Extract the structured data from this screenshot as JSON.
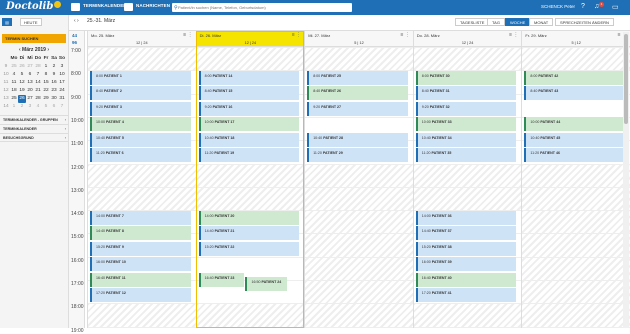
{
  "topbar": {
    "logo": "Doctolib",
    "logo_badge": "pro",
    "nav_calendar": "TERMINKALENDER",
    "nav_messages": "NACHRICHTEN",
    "search_placeholder": "Patient/in suchen (Name, Telefon, Geburtsdatum)",
    "user_name": "SCHENCK Peter",
    "notif_count": "1"
  },
  "sidebar": {
    "heute": "HEUTE",
    "termin_suchen": "TERMIN SUCHEN",
    "month": "März",
    "year": "2019",
    "weekday_headers": [
      "Mo",
      "Di",
      "Mi",
      "Do",
      "Fr",
      "Sa",
      "So"
    ],
    "weeks": [
      {
        "wk": "9",
        "days": [
          "25",
          "26",
          "27",
          "28",
          "1",
          "2",
          "3"
        ]
      },
      {
        "wk": "10",
        "days": [
          "4",
          "5",
          "6",
          "7",
          "8",
          "9",
          "10"
        ]
      },
      {
        "wk": "11",
        "days": [
          "11",
          "12",
          "13",
          "14",
          "15",
          "16",
          "17"
        ]
      },
      {
        "wk": "12",
        "days": [
          "18",
          "19",
          "20",
          "21",
          "22",
          "23",
          "24"
        ]
      },
      {
        "wk": "13",
        "days": [
          "25",
          "26",
          "27",
          "28",
          "29",
          "30",
          "31"
        ]
      },
      {
        "wk": "14",
        "days": [
          "1",
          "2",
          "3",
          "4",
          "5",
          "6",
          "7"
        ]
      }
    ],
    "sections": [
      "TERMINKALENDER - GRUPPEN",
      "TERMINKALENDER",
      "BESUCHSGRUND"
    ]
  },
  "toolbar": {
    "date_range": "25.-31. März",
    "views": [
      "TAGESLISTE",
      "TAG",
      "WOCHE",
      "MONAT",
      "SPRECHZEITEN ÄNDERN"
    ],
    "active_view": "WOCHE"
  },
  "zoom": {
    "a": "44",
    "b": "96"
  },
  "hours": [
    "7:00",
    "8:00",
    "9:00",
    "10:00",
    "11:00",
    "12:00",
    "13:00",
    "14:00",
    "15:00",
    "16:00",
    "17:00",
    "18:00",
    "19:00"
  ],
  "days": [
    {
      "title": "Mo. 25. März",
      "count": "12 | 24"
    },
    {
      "title": "Di. 26. März",
      "count": "12 | 24"
    },
    {
      "title": "Mi. 27. März",
      "count": "5 | 12"
    },
    {
      "title": "Do. 28. März",
      "count": "12 | 24"
    },
    {
      "title": "Fr. 29. März",
      "count": "5 | 12"
    }
  ],
  "appointments": [
    {
      "day": 0,
      "t": "8:00",
      "n": "PATIENT 1"
    },
    {
      "day": 0,
      "t": "8:40",
      "n": "PATIENT 2"
    },
    {
      "day": 0,
      "t": "9:20",
      "n": "PATIENT 3"
    },
    {
      "day": 0,
      "t": "10:00",
      "n": "PATIENT 4",
      "g": true
    },
    {
      "day": 0,
      "t": "10:40",
      "n": "PATIENT 5"
    },
    {
      "day": 0,
      "t": "11:20",
      "n": "PATIENT 6"
    },
    {
      "day": 0,
      "t": "14:00",
      "n": "PATIENT 7"
    },
    {
      "day": 0,
      "t": "14:40",
      "n": "PATIENT 8",
      "g": true
    },
    {
      "day": 0,
      "t": "15:20",
      "n": "PATIENT 9"
    },
    {
      "day": 0,
      "t": "16:00",
      "n": "PATIENT 10"
    },
    {
      "day": 0,
      "t": "16:40",
      "n": "PATIENT 11",
      "g": true
    },
    {
      "day": 0,
      "t": "17:20",
      "n": "PATIENT 12"
    },
    {
      "day": 1,
      "t": "8:00",
      "n": "PATIENT 14"
    },
    {
      "day": 1,
      "t": "8:40",
      "n": "PATIENT 15"
    },
    {
      "day": 1,
      "t": "9:20",
      "n": "PATIENT 16"
    },
    {
      "day": 1,
      "t": "10:00",
      "n": "PATIENT 17",
      "g": true
    },
    {
      "day": 1,
      "t": "10:40",
      "n": "PATIENT 18"
    },
    {
      "day": 1,
      "t": "11:20",
      "n": "PATIENT 19"
    },
    {
      "day": 1,
      "t": "14:00",
      "n": "PATIENT 20",
      "g": true
    },
    {
      "day": 1,
      "t": "14:40",
      "n": "PATIENT 21"
    },
    {
      "day": 1,
      "t": "15:20",
      "n": "PATIENT 22"
    },
    {
      "day": 1,
      "t": "16:40",
      "n": "PATIENT 23",
      "g": true
    },
    {
      "day": 1,
      "t": "16:50",
      "n": "PATIENT 24",
      "g": true
    },
    {
      "day": 2,
      "t": "8:00",
      "n": "PATIENT 25"
    },
    {
      "day": 2,
      "t": "8:40",
      "n": "PATIENT 26",
      "g": true
    },
    {
      "day": 2,
      "t": "9:20",
      "n": "PATIENT 27"
    },
    {
      "day": 2,
      "t": "10:40",
      "n": "PATIENT 28"
    },
    {
      "day": 2,
      "t": "11:20",
      "n": "PATIENT 29"
    },
    {
      "day": 3,
      "t": "8:00",
      "n": "PATIENT 30",
      "g": true
    },
    {
      "day": 3,
      "t": "8:40",
      "n": "PATIENT 31"
    },
    {
      "day": 3,
      "t": "9:20",
      "n": "PATIENT 32"
    },
    {
      "day": 3,
      "t": "10:00",
      "n": "PATIENT 33",
      "g": true
    },
    {
      "day": 3,
      "t": "10:40",
      "n": "PATIENT 34"
    },
    {
      "day": 3,
      "t": "11:20",
      "n": "PATIENT 35"
    },
    {
      "day": 3,
      "t": "14:00",
      "n": "PATIENT 36"
    },
    {
      "day": 3,
      "t": "14:40",
      "n": "PATIENT 37"
    },
    {
      "day": 3,
      "t": "15:20",
      "n": "PATIENT 38"
    },
    {
      "day": 3,
      "t": "16:00",
      "n": "PATIENT 39"
    },
    {
      "day": 3,
      "t": "16:40",
      "n": "PATIENT 40",
      "g": true
    },
    {
      "day": 3,
      "t": "17:20",
      "n": "PATIENT 41"
    },
    {
      "day": 4,
      "t": "8:00",
      "n": "PATIENT 42",
      "g": true
    },
    {
      "day": 4,
      "t": "8:40",
      "n": "PATIENT 43"
    },
    {
      "day": 4,
      "t": "10:00",
      "n": "PATIENT 44",
      "g": true
    },
    {
      "day": 4,
      "t": "10:40",
      "n": "PATIENT 45"
    },
    {
      "day": 4,
      "t": "11:20",
      "n": "PATIENT 46"
    }
  ]
}
